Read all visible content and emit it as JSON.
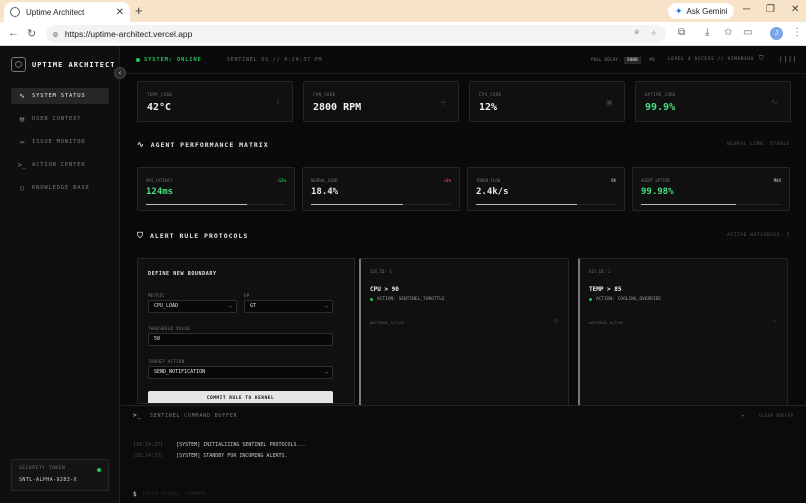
{
  "browser": {
    "tab_title": "Uptime Architect",
    "tab_close": "✕",
    "new_tab": "+",
    "url": "https://uptime-architect.vercel.app",
    "ask_gemini": "Ask Gemini",
    "profile_initial": "J",
    "icons": [
      "favicon-icon",
      "zoom-icon",
      "star-icon",
      "extensions-icon",
      "download-icon",
      "bookmark-icon",
      "split-icon",
      "menu-icon"
    ]
  },
  "sidebar": {
    "brand": "UPTIME ARCHITECT",
    "collapse_icon": "‹",
    "items": [
      {
        "label": "SYSTEM STATUS",
        "icon": "activity-icon",
        "glyph": "∿",
        "active": true
      },
      {
        "label": "USER CONTEXT",
        "icon": "database-icon",
        "glyph": "▤",
        "active": false
      },
      {
        "label": "ISSUE MONITOR",
        "icon": "message-icon",
        "glyph": "▭",
        "active": false
      },
      {
        "label": "ACTION CENTER",
        "icon": "terminal-icon",
        "glyph": ">_",
        "active": false
      },
      {
        "label": "KNOWLEDGE BASE",
        "icon": "circle-icon",
        "glyph": "○",
        "active": false
      }
    ],
    "token": {
      "label": "SECURITY TOKEN",
      "value": "SNTL-ALPHA-9283-X"
    }
  },
  "topbar": {
    "status": "SYSTEM: ONLINE",
    "sentinel": "SENTINEL OS // 4:24:37 PM",
    "poll_label": "POLL DELAY:",
    "poll_value": "5000",
    "poll_unit": "MS",
    "access_level": "LEVEL 4 ACCESS // HIMANSHU"
  },
  "stats": [
    {
      "label": "TEMP_CORE",
      "value": "42°C",
      "icon": "thermometer-icon",
      "glyph": "⌇",
      "accent": false
    },
    {
      "label": "FAN_CORE",
      "value": "2800 RPM",
      "icon": "fan-icon",
      "glyph": "✢",
      "accent": false
    },
    {
      "label": "CPU_CORE",
      "value": "12%",
      "icon": "cpu-icon",
      "glyph": "▣",
      "accent": false
    },
    {
      "label": "UPTIME_CORE",
      "value": "99.9%",
      "icon": "pulse-icon",
      "glyph": "∿",
      "accent": true
    }
  ],
  "matrix": {
    "title": "AGENT PERFORMANCE MATRIX",
    "status": "NEURAL LINK: STABLE",
    "cards": [
      {
        "label": "API_LATENCY",
        "value": "124ms",
        "delta": "-12%",
        "delta_color": "#22c55e",
        "progress": 0.72,
        "accent": true
      },
      {
        "label": "NEURAL_LOAD",
        "value": "18.4%",
        "delta": "+2%",
        "delta_color": "#ef4444",
        "progress": 0.66,
        "accent": false
      },
      {
        "label": "TOKEN_FLOW",
        "value": "2.4k/s",
        "delta": "OK",
        "delta_color": "#9ca3af",
        "progress": 0.72,
        "accent": false
      },
      {
        "label": "AGENT_UPTIME",
        "value": "99.98%",
        "delta": "MAX",
        "delta_color": "#9ca3af",
        "progress": 0.68,
        "accent": true
      }
    ]
  },
  "alerts": {
    "title": "ALERT RULE PROTOCOLS",
    "active": "ACTIVE WATCHDOGS: 2",
    "form": {
      "title": "DEFINE NEW BOUNDARY",
      "metric_label": "METRIC",
      "metric_value": "CPU_LOAD",
      "op_label": "OP",
      "op_value": "GT",
      "threshold_label": "THRESHOLD VALUE",
      "threshold_value": "50",
      "action_label": "TARGET ACTION",
      "action_value": "SEND_NOTIFICATION",
      "commit": "COMMIT RULE TO KERNEL"
    },
    "rules": [
      {
        "id": "SIG_ID: 1",
        "condition": "CPU > 90",
        "action": "ACTION: SENTINEL_THROTTLE",
        "watch": "WATCHDOG_ACTIVE"
      },
      {
        "id": "SIG_ID: 2",
        "condition": "TEMP > 85",
        "action": "ACTION: COOLING_OVERRIDE",
        "watch": "WATCHDOG_ACTIVE"
      }
    ]
  },
  "console": {
    "title": "SENTINEL COMMAND BUFFER",
    "clear": "CLEAR BUFFER",
    "lines": [
      {
        "time": "[16:24:37]",
        "text": "[SYSTEM] INITIALIZING SENTINEL PROTOCOLS..."
      },
      {
        "time": "[16:24:37]",
        "text": "[SYSTEM] STANDBY FOR INCOMING ALERTS."
      }
    ],
    "prompt": "$",
    "input_placeholder": "ENTER KERNEL COMMAND..."
  }
}
